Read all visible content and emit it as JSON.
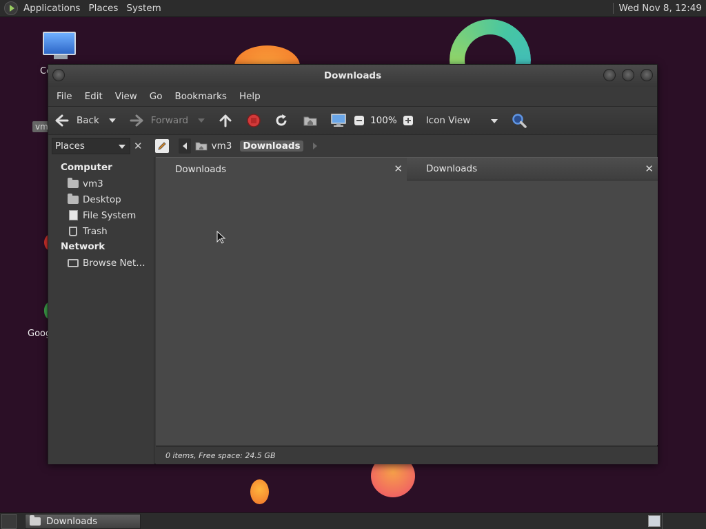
{
  "top_panel": {
    "menus": [
      "Applications",
      "Places",
      "System"
    ],
    "clock": "Wed Nov 8, 12:49"
  },
  "desktop": {
    "icon1_label": "Co",
    "icon_tag": "vm",
    "icon3_label": "Goog"
  },
  "window": {
    "title": "Downloads",
    "menubar": [
      "File",
      "Edit",
      "View",
      "Go",
      "Bookmarks",
      "Help"
    ],
    "toolbar": {
      "back": "Back",
      "forward": "Forward",
      "zoom": "100%",
      "view_mode": "Icon View"
    },
    "locbar": {
      "places": "Places",
      "crumbs": [
        "vm3",
        "Downloads"
      ]
    },
    "sidebar": {
      "sections": [
        {
          "title": "Computer",
          "items": [
            "vm3",
            "Desktop",
            "File System",
            "Trash"
          ]
        },
        {
          "title": "Network",
          "items": [
            "Browse Net…"
          ]
        }
      ]
    },
    "tabs": [
      "Downloads",
      "Downloads"
    ],
    "status": "0 items, Free space: 24.5 GB"
  },
  "taskbar": {
    "task_label": "Downloads"
  },
  "colors": {
    "desktop_bg": "#2b0f26",
    "panel_bg": "#2c2c2c",
    "window_bg": "#3a3a3a",
    "pane_bg": "#484848",
    "stop_red": "#d23a3a",
    "search_blue": "#3f78d0"
  }
}
